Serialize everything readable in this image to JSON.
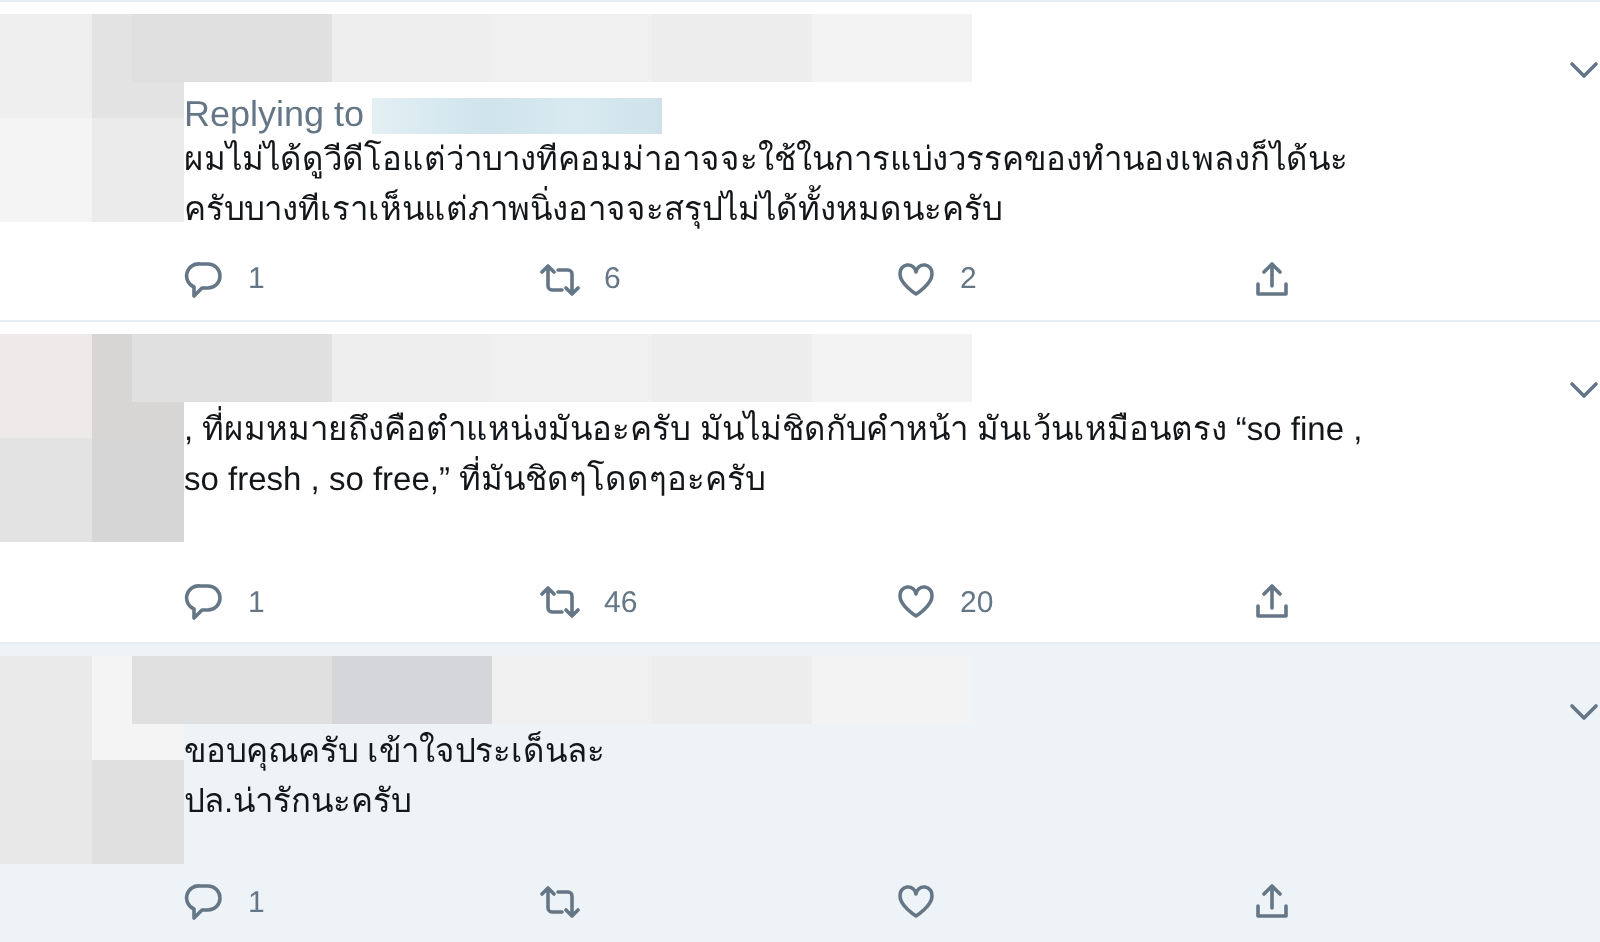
{
  "tweets": [
    {
      "highlighted": false,
      "replying_to": "Replying to",
      "text_lines": [
        "ผมไม่ได้ดูวีดีโอแต่ว่าบางทีคอมม่าอาจจะใช้ในการแบ่งวรรคของทำนองเพลงก็ได้นะ",
        "ครับบางทีเราเห็นแต่ภาพนิ่งอาจจะสรุปไม่ได้ทั้งหมดนะครับ"
      ],
      "replies": "1",
      "retweets": "6",
      "likes": "2"
    },
    {
      "highlighted": false,
      "text_lines": [
        ", ที่ผมหมายถึงคือตำแหน่งมันอะครับ มันไม่ชิดกับคำหน้า มันเว้นเหมือนตรง “so fine ,",
        "so fresh , so free,” ที่มันชิดๆโดดๆอะครับ"
      ],
      "replies": "1",
      "retweets": "46",
      "likes": "20"
    },
    {
      "highlighted": true,
      "text_lines": [
        "ขอบคุณครับ เข้าใจประเด็นละ",
        "ปล.น่ารักนะครับ"
      ],
      "replies": "1"
    }
  ]
}
